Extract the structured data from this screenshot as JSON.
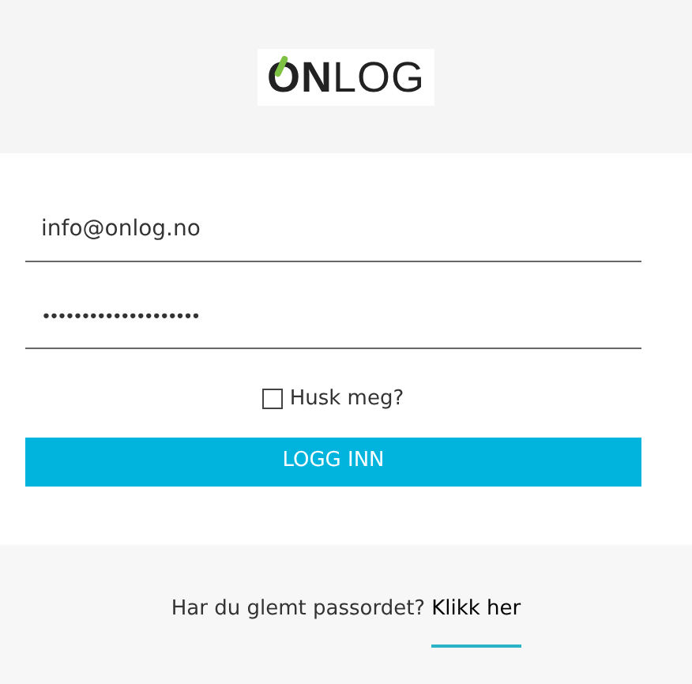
{
  "logo": {
    "text": "**ON**LOG"
  },
  "email": {
    "value": "info@onlog.no"
  },
  "password": {
    "value": "••••••••••••••••••••"
  },
  "remember": {
    "label": "Husk meg?",
    "checked": false
  },
  "login_button": {
    "label": "LOGG INN"
  },
  "forgot": {
    "text": "Har du glemt passordet?",
    "link": "Klikk her"
  }
}
